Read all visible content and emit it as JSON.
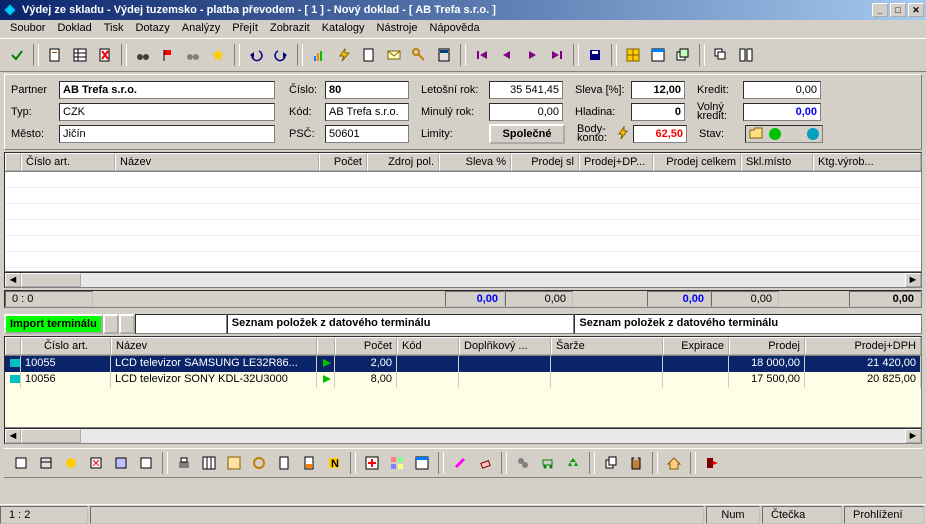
{
  "title": "Výdej ze skladu - Výdej tuzemsko - platba převodem - [ 1 ]  - Nový doklad - [ AB Trefa s.r.o. ]",
  "menu": [
    "Soubor",
    "Doklad",
    "Tisk",
    "Dotazy",
    "Analýzy",
    "Přejít",
    "Zobrazit",
    "Katalogy",
    "Nástroje",
    "Nápověda"
  ],
  "form": {
    "partner_lbl": "Partner",
    "partner": "AB Trefa s.r.o.",
    "typ_lbl": "Typ:",
    "typ": "CZK",
    "mesto_lbl": "Město:",
    "mesto": "Jičín",
    "cislo_lbl": "Číslo:",
    "cislo": "80",
    "kod_lbl": "Kód:",
    "kod": "AB Trefa s.r.o.",
    "psc_lbl": "PSČ:",
    "psc": "50601",
    "letosni_lbl": "Letošní rok:",
    "letosni": "35 541,45",
    "minuly_lbl": "Minulý rok:",
    "minuly": "0,00",
    "limity_lbl": "Limity:",
    "limity_btn": "Společné",
    "sleva_lbl": "Sleva [%]:",
    "sleva": "12,00",
    "hladina_lbl": "Hladina:",
    "hladina": "0",
    "body_lbl": "Body-konto:",
    "body": "62,50",
    "kredit_lbl": "Kredit:",
    "kredit": "0,00",
    "volny_lbl": "Volný kredit:",
    "volny": "0,00",
    "stav_lbl": "Stav:"
  },
  "grid1": {
    "cols": [
      "Číslo art.",
      "Název",
      "Počet",
      "Zdroj pol.",
      "Sleva %",
      "Prodej sl",
      "Prodej+DP...",
      "Prodej celkem",
      "Skl.místo",
      "Ktg.výrob..."
    ]
  },
  "sum1": {
    "pos": "0 :   0",
    "v1": "0,00",
    "v2": "0,00",
    "v3": "0,00",
    "v4": "0,00",
    "v5": "0,00"
  },
  "import": {
    "btn": "Import terminálu",
    "label1": "Seznam položek z datového terminálu",
    "label2": "Seznam položek z datového terminálu"
  },
  "grid2": {
    "cols": [
      "",
      "Číslo art.",
      "Název",
      "",
      "Počet",
      "Kód",
      "Doplňkový ...",
      "Šarže",
      "Expirace",
      "Prodej",
      "Prodej+DPH"
    ],
    "rows": [
      {
        "art": "10055",
        "naz": "LCD televizor SAMSUNG LE32R86...",
        "poc": "2,00",
        "prodej": "18 000,00",
        "dph": "21 420,00",
        "sel": true
      },
      {
        "art": "10056",
        "naz": "LCD televizor  SONY KDL-32U3000",
        "poc": "8,00",
        "prodej": "17 500,00",
        "dph": "20 825,00",
        "sel": false
      }
    ]
  },
  "status": {
    "pos": "1 :   2",
    "num": "Num",
    "ctecka": "Čtečka",
    "prohl": "Prohlížení"
  }
}
